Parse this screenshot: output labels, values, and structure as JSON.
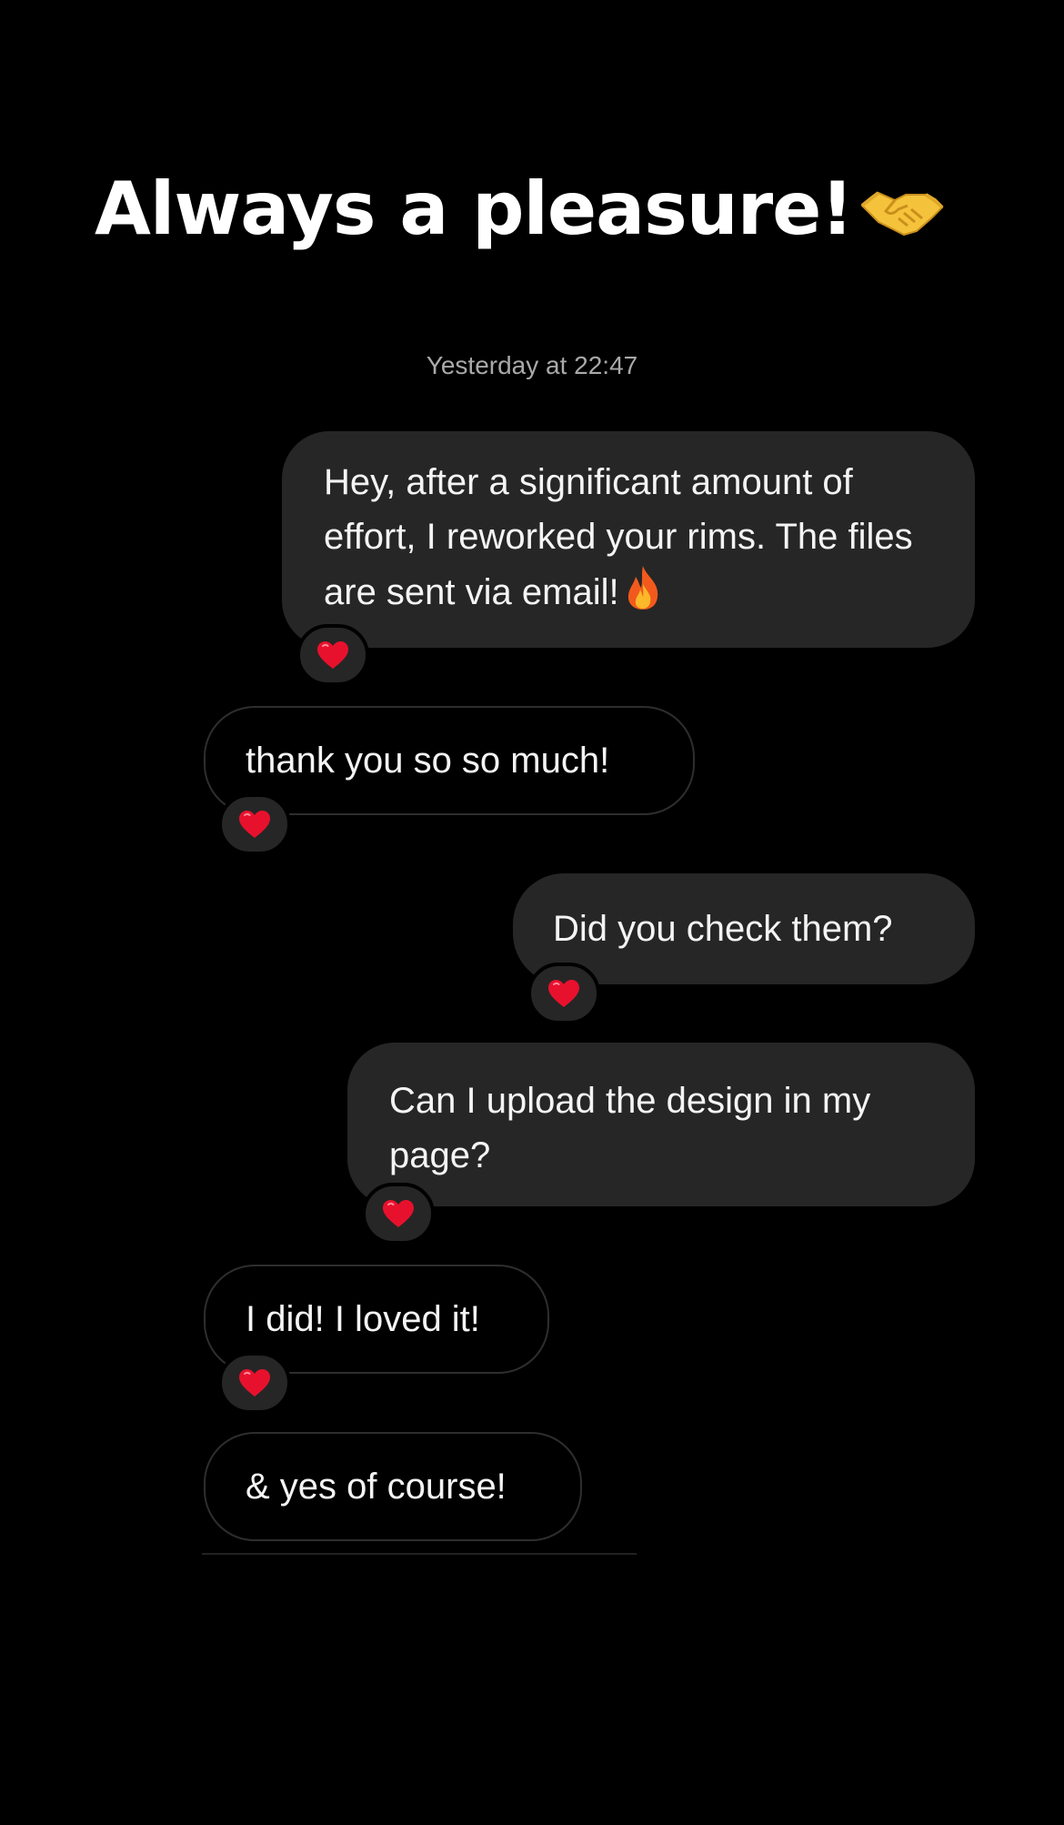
{
  "story": {
    "headline": "Always a pleasure!",
    "headline_emoji": "handshake-emoji"
  },
  "thread": {
    "timestamp": "Yesterday at 22:47",
    "messages": [
      {
        "side": "sent",
        "text": "Hey, after a significant amount of effort, I reworked your rims. The files are sent via email!",
        "trailing_emoji": "fire-emoji",
        "reaction": "red-heart"
      },
      {
        "side": "received",
        "text": "thank you so so much!",
        "reaction": "red-heart"
      },
      {
        "side": "sent",
        "text": "Did you check them?",
        "reaction": "red-heart"
      },
      {
        "side": "sent",
        "text": "Can I upload the design in my page?",
        "reaction": "red-heart"
      },
      {
        "side": "received",
        "text": "I did! I loved it!",
        "reaction": "red-heart"
      },
      {
        "side": "received",
        "text": "& yes of course!"
      }
    ]
  },
  "colors": {
    "background": "#000000",
    "sent_bubble": "#262626",
    "received_border": "#2e2e2e",
    "timestamp": "#a9a9a9",
    "heart": "#e8112d"
  }
}
